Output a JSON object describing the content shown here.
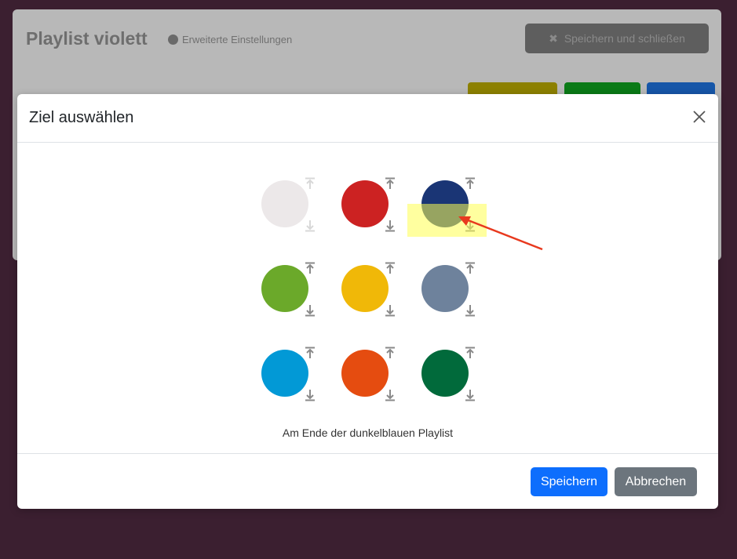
{
  "background": {
    "title": "Playlist violett",
    "settings_link": "Erweiterte Einstellungen",
    "close_button": "Speichern und schließen"
  },
  "modal": {
    "title": "Ziel auswählen",
    "status": "Am Ende der dunkelblauen Playlist",
    "save_label": "Speichern",
    "cancel_label": "Abbrechen"
  },
  "swatches": [
    {
      "color": "#ece8e9",
      "faded": true
    },
    {
      "color": "#cc2222"
    },
    {
      "color": "#1a3575",
      "selected": true
    },
    {
      "color": "#6ba92a"
    },
    {
      "color": "#f0b808"
    },
    {
      "color": "#6e829c"
    },
    {
      "color": "#0299d6"
    },
    {
      "color": "#e54c10"
    },
    {
      "color": "#016a3b"
    }
  ],
  "colors": {
    "primary": "#0d6efd",
    "secondary": "#6c757d",
    "highlight": "#ffff50",
    "annotation_arrow": "#e8391e"
  }
}
